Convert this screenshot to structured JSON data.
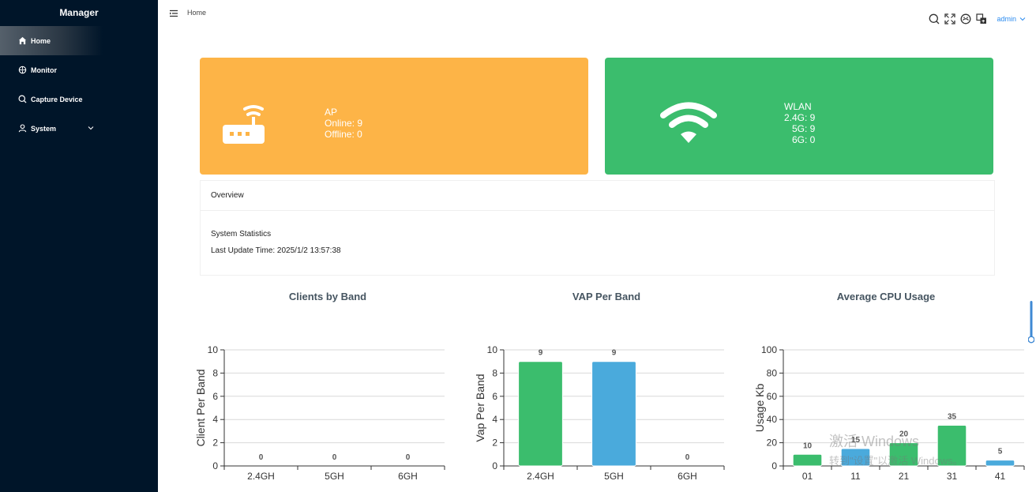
{
  "sidebar": {
    "brand": "Manager",
    "items": [
      {
        "label": "Home",
        "icon": "home-icon"
      },
      {
        "label": "Monitor",
        "icon": "monitor-icon"
      },
      {
        "label": "Capture Device",
        "icon": "search-icon"
      },
      {
        "label": "System",
        "icon": "user-icon"
      }
    ]
  },
  "header": {
    "breadcrumb": "Home",
    "user": "admin",
    "icons": [
      "search-icon",
      "fullscreen-icon",
      "theme-icon",
      "translate-icon"
    ]
  },
  "cards": {
    "ap": {
      "title": "AP",
      "online": "Online: 9",
      "offline": "Offline: 0",
      "color": "#fdb447"
    },
    "wlan": {
      "title": "WLAN",
      "g24": "2.4G: 9",
      "g5": "5G: 9",
      "g6": "6G: 0",
      "color": "#3bbd6d"
    }
  },
  "overview": {
    "title": "Overview",
    "subtitle": "System Statistics",
    "updated": "Last Update Time: 2025/1/2 13:57:38"
  },
  "chart_titles": [
    "Clients by Band",
    "VAP Per Band",
    "Average CPU Usage"
  ],
  "watermark": {
    "line1": "激活 Windows",
    "line2": "转到\"设置\"以激活 Windows。"
  },
  "chart_data": [
    {
      "type": "bar",
      "title": "Clients by Band",
      "ylabel": "Client Per Band",
      "categories": [
        "2.4GH",
        "5GH",
        "6GH"
      ],
      "values": [
        0,
        0,
        0
      ],
      "ylim": [
        0,
        10
      ],
      "yticks": [
        0,
        2,
        4,
        6,
        8,
        10
      ],
      "colors": [
        "#3bbd6d",
        "#4aaadc",
        "#3bbd6d"
      ],
      "grid": true
    },
    {
      "type": "bar",
      "title": "VAP Per Band",
      "ylabel": "Vap Per Band",
      "categories": [
        "2.4GH",
        "5GH",
        "6GH"
      ],
      "values": [
        9,
        9,
        0
      ],
      "ylim": [
        0,
        10
      ],
      "yticks": [
        0,
        2,
        4,
        6,
        8,
        10
      ],
      "colors": [
        "#3bbd6d",
        "#4aaadc",
        "#3bbd6d"
      ],
      "grid": true
    },
    {
      "type": "bar",
      "title": "Average CPU Usage",
      "ylabel": "Usage Kb",
      "categories": [
        "01",
        "11",
        "21",
        "31",
        "41"
      ],
      "values": [
        10,
        15,
        20,
        35,
        5
      ],
      "ylim": [
        0,
        100
      ],
      "yticks": [
        0,
        20,
        40,
        60,
        80,
        100
      ],
      "colors": [
        "#3bbd6d",
        "#4aaadc",
        "#3bbd6d",
        "#3bbd6d",
        "#4aaadc"
      ],
      "grid": true
    }
  ]
}
